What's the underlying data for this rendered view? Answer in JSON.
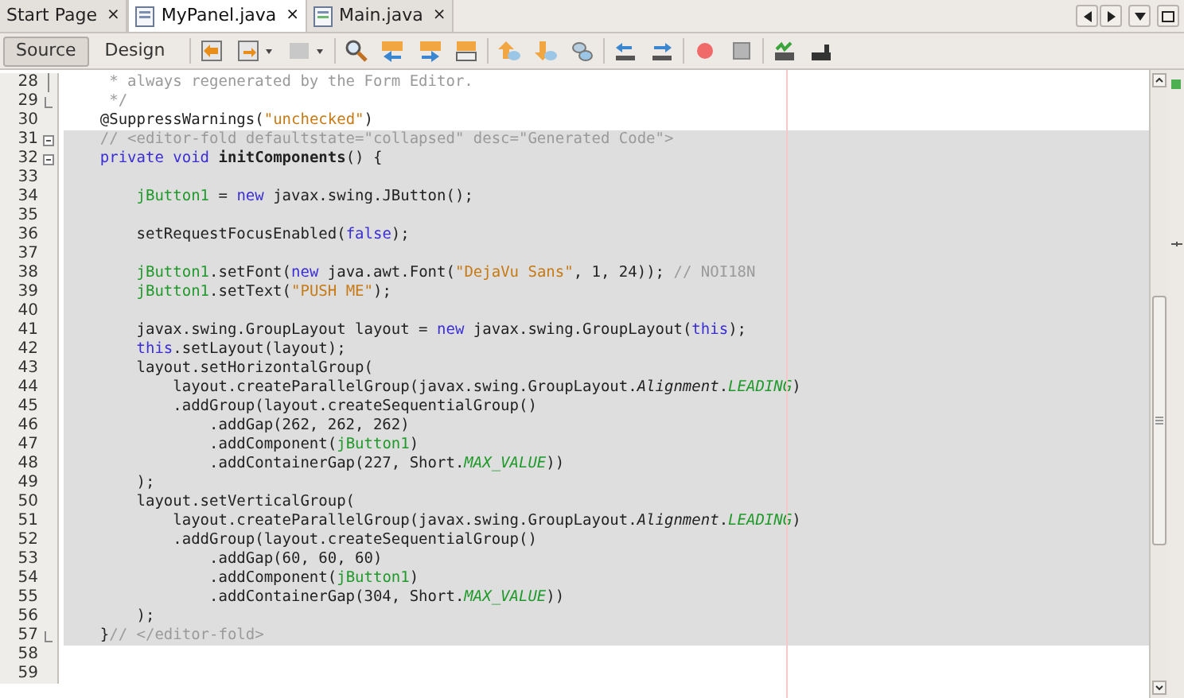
{
  "tabs": [
    {
      "label": "Start Page",
      "icon": false,
      "selected": false,
      "close": "×"
    },
    {
      "label": "MyPanel.java",
      "icon": true,
      "selected": true,
      "close": "×"
    },
    {
      "label": "Main.java",
      "icon": true,
      "selected": false,
      "close": "×"
    }
  ],
  "views": [
    {
      "label": "Source",
      "selected": true
    },
    {
      "label": "Design",
      "selected": false
    }
  ],
  "lines": [
    {
      "number": "28",
      "guarded": false,
      "fold_line": true,
      "tokens": [
        {
          "kind": "comment",
          "text": "     * always regenerated by the Form Editor."
        }
      ]
    },
    {
      "number": "29",
      "guarded": false,
      "fold_end": true,
      "tokens": [
        {
          "kind": "comment",
          "text": "     */"
        }
      ]
    },
    {
      "number": "30",
      "guarded": false,
      "tokens": [
        {
          "kind": "plain",
          "text": "    @SuppressWarnings("
        },
        {
          "kind": "string",
          "text": "\"unchecked\""
        },
        {
          "kind": "plain",
          "text": ")"
        }
      ]
    },
    {
      "number": "31",
      "guarded": true,
      "fold_start": true,
      "tokens": [
        {
          "kind": "comment",
          "text": "    // <editor-fold defaultstate=\"collapsed\" desc=\"Generated Code\">"
        }
      ]
    },
    {
      "number": "32",
      "guarded": true,
      "fold_start": true,
      "tokens": [
        {
          "kind": "keyword",
          "text": "    private"
        },
        {
          "kind": "keyword",
          "text": " void"
        },
        {
          "kind": "declaration",
          "text": " initComponents"
        },
        {
          "kind": "plain",
          "text": "() {"
        }
      ]
    },
    {
      "number": "33",
      "guarded": true
    },
    {
      "number": "34",
      "guarded": true,
      "tokens": [
        {
          "kind": "field",
          "text": "        jButton1"
        },
        {
          "kind": "plain",
          "text": " = "
        },
        {
          "kind": "keyword",
          "text": "new"
        },
        {
          "kind": "plain",
          "text": " javax.swing.JButton();"
        }
      ]
    },
    {
      "number": "35",
      "guarded": true
    },
    {
      "number": "36",
      "guarded": true,
      "tokens": [
        {
          "kind": "plain",
          "text": "        setRequestFocusEnabled("
        },
        {
          "kind": "keyword",
          "text": "false"
        },
        {
          "kind": "plain",
          "text": ");"
        }
      ]
    },
    {
      "number": "37",
      "guarded": true
    },
    {
      "number": "38",
      "guarded": true,
      "tokens": [
        {
          "kind": "field",
          "text": "        jButton1"
        },
        {
          "kind": "plain",
          "text": ".setFont("
        },
        {
          "kind": "keyword",
          "text": "new"
        },
        {
          "kind": "plain",
          "text": " java.awt.Font("
        },
        {
          "kind": "string",
          "text": "\"DejaVu Sans\""
        },
        {
          "kind": "plain",
          "text": ", 1, 24)); "
        },
        {
          "kind": "comment",
          "text": "// NOI18N"
        }
      ]
    },
    {
      "number": "39",
      "guarded": true,
      "tokens": [
        {
          "kind": "field",
          "text": "        jButton1"
        },
        {
          "kind": "plain",
          "text": ".setText("
        },
        {
          "kind": "string",
          "text": "\"PUSH ME\""
        },
        {
          "kind": "plain",
          "text": ");"
        }
      ]
    },
    {
      "number": "40",
      "guarded": true
    },
    {
      "number": "41",
      "guarded": true,
      "tokens": [
        {
          "kind": "plain",
          "text": "        javax.swing.GroupLayout layout = "
        },
        {
          "kind": "keyword",
          "text": "new"
        },
        {
          "kind": "plain",
          "text": " javax.swing.GroupLayout("
        },
        {
          "kind": "keyword",
          "text": "this"
        },
        {
          "kind": "plain",
          "text": ");"
        }
      ]
    },
    {
      "number": "42",
      "guarded": true,
      "tokens": [
        {
          "kind": "keyword",
          "text": "        this"
        },
        {
          "kind": "plain",
          "text": ".setLayout(layout);"
        }
      ]
    },
    {
      "number": "43",
      "guarded": true,
      "tokens": [
        {
          "kind": "plain",
          "text": "        layout.setHorizontalGroup("
        }
      ]
    },
    {
      "number": "44",
      "guarded": true,
      "tokens": [
        {
          "kind": "plain",
          "text": "            layout.createParallelGroup(javax.swing.GroupLayout."
        },
        {
          "kind": "italic",
          "text": "Alignment"
        },
        {
          "kind": "plain",
          "text": "."
        },
        {
          "kind": "constant",
          "text": "LEADING"
        },
        {
          "kind": "plain",
          "text": ")"
        }
      ]
    },
    {
      "number": "45",
      "guarded": true,
      "tokens": [
        {
          "kind": "plain",
          "text": "            .addGroup(layout.createSequentialGroup()"
        }
      ]
    },
    {
      "number": "46",
      "guarded": true,
      "tokens": [
        {
          "kind": "plain",
          "text": "                .addGap(262, 262, 262)"
        }
      ]
    },
    {
      "number": "47",
      "guarded": true,
      "tokens": [
        {
          "kind": "plain",
          "text": "                .addComponent("
        },
        {
          "kind": "field",
          "text": "jButton1"
        },
        {
          "kind": "plain",
          "text": ")"
        }
      ]
    },
    {
      "number": "48",
      "guarded": true,
      "tokens": [
        {
          "kind": "plain",
          "text": "                .addContainerGap(227, Short."
        },
        {
          "kind": "constant",
          "text": "MAX_VALUE"
        },
        {
          "kind": "plain",
          "text": "))"
        }
      ]
    },
    {
      "number": "49",
      "guarded": true,
      "tokens": [
        {
          "kind": "plain",
          "text": "        );"
        }
      ]
    },
    {
      "number": "50",
      "guarded": true,
      "tokens": [
        {
          "kind": "plain",
          "text": "        layout.setVerticalGroup("
        }
      ]
    },
    {
      "number": "51",
      "guarded": true,
      "tokens": [
        {
          "kind": "plain",
          "text": "            layout.createParallelGroup(javax.swing.GroupLayout."
        },
        {
          "kind": "italic",
          "text": "Alignment"
        },
        {
          "kind": "plain",
          "text": "."
        },
        {
          "kind": "constant",
          "text": "LEADING"
        },
        {
          "kind": "plain",
          "text": ")"
        }
      ]
    },
    {
      "number": "52",
      "guarded": true,
      "tokens": [
        {
          "kind": "plain",
          "text": "            .addGroup(layout.createSequentialGroup()"
        }
      ]
    },
    {
      "number": "53",
      "guarded": true,
      "tokens": [
        {
          "kind": "plain",
          "text": "                .addGap(60, 60, 60)"
        }
      ]
    },
    {
      "number": "54",
      "guarded": true,
      "tokens": [
        {
          "kind": "plain",
          "text": "                .addComponent("
        },
        {
          "kind": "field",
          "text": "jButton1"
        },
        {
          "kind": "plain",
          "text": ")"
        }
      ]
    },
    {
      "number": "55",
      "guarded": true,
      "tokens": [
        {
          "kind": "plain",
          "text": "                .addContainerGap(304, Short."
        },
        {
          "kind": "constant",
          "text": "MAX_VALUE"
        },
        {
          "kind": "plain",
          "text": "))"
        }
      ]
    },
    {
      "number": "56",
      "guarded": true,
      "tokens": [
        {
          "kind": "plain",
          "text": "        );"
        }
      ]
    },
    {
      "number": "57",
      "guarded": true,
      "fold_end": true,
      "tokens": [
        {
          "kind": "plain",
          "text": "    }"
        },
        {
          "kind": "comment",
          "text": "// </editor-fold>"
        }
      ]
    },
    {
      "number": "58",
      "guarded": false
    },
    {
      "number": "59",
      "guarded": false
    }
  ]
}
